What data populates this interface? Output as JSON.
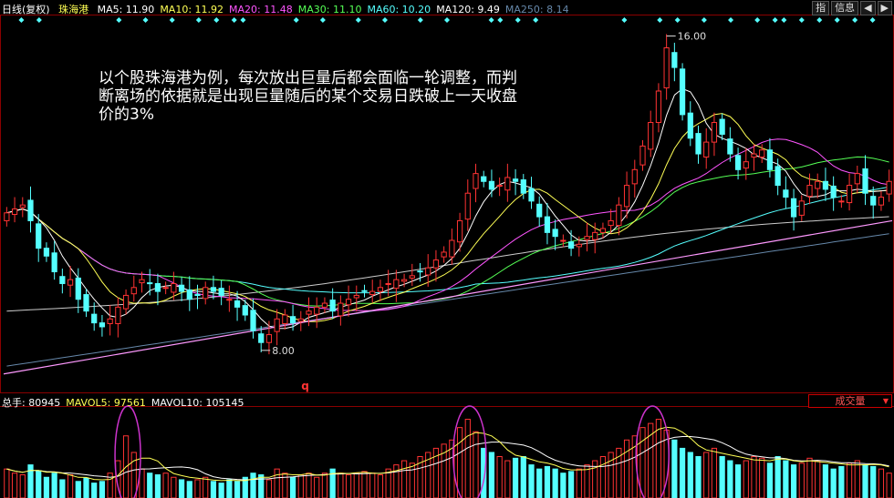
{
  "header": {
    "period": "日线(复权)",
    "stock": "珠海港",
    "ma_items": [
      {
        "text": "MA5: 11.90",
        "color": "#ffffff"
      },
      {
        "text": "MA10: 11.92",
        "color": "#ffff55"
      },
      {
        "text": "MA20: 11.48",
        "color": "#ff55ff"
      },
      {
        "text": "MA30: 11.10",
        "color": "#55ff55"
      },
      {
        "text": "MA60: 10.20",
        "color": "#55ffff"
      },
      {
        "text": "MA120: 9.49",
        "color": "#ffffff"
      },
      {
        "text": "MA250: 8.14",
        "color": "#6688aa"
      }
    ]
  },
  "top_buttons": [
    "指",
    "信息",
    "◀",
    "▶"
  ],
  "annotation": "以个股珠海港为例，每次放出巨量后都会面临一轮调整，而判断离场的依据就是出现巨量随后的某个交易日跌破上一天收盘价的3%",
  "marker_q": "q",
  "volume_header": {
    "items": [
      {
        "text": "总手: 80945",
        "color": "#ffffff"
      },
      {
        "text": "MAVOL5: 97561",
        "color": "#ffff55"
      },
      {
        "text": "MAVOL10: 105145",
        "color": "#ffffff"
      }
    ]
  },
  "volume_selector": "成交量",
  "chart_data": {
    "type": "candlestick",
    "price_range": [
      7.0,
      16.5
    ],
    "high_label": "16.00",
    "low_label": "8.00",
    "high_value": 16.0,
    "low_value": 8.0,
    "closes": [
      11.5,
      11.6,
      11.7,
      11.3,
      10.6,
      10.4,
      10.0,
      9.7,
      9.8,
      9.3,
      9.0,
      8.7,
      8.6,
      8.8,
      9.1,
      9.4,
      9.6,
      9.8,
      9.7,
      9.5,
      9.6,
      9.7,
      9.5,
      9.3,
      9.4,
      9.6,
      9.5,
      9.4,
      9.3,
      9.1,
      8.9,
      8.5,
      8.2,
      8.4,
      8.8,
      8.9,
      8.7,
      8.8,
      9.0,
      9.1,
      9.2,
      9.0,
      9.2,
      9.3,
      9.4,
      9.5,
      9.5,
      9.6,
      9.7,
      9.8,
      9.8,
      9.9,
      10.0,
      10.1,
      10.3,
      10.5,
      10.8,
      11.3,
      12.0,
      12.5,
      12.3,
      12.1,
      12.2,
      12.4,
      12.3,
      12.0,
      11.8,
      11.4,
      11.0,
      10.9,
      10.8,
      10.6,
      10.7,
      10.9,
      11.0,
      11.1,
      11.3,
      11.7,
      12.2,
      12.6,
      13.2,
      13.8,
      14.6,
      15.7,
      15.2,
      14.0,
      13.4,
      13.0,
      13.3,
      13.8,
      13.5,
      13.0,
      12.6,
      12.8,
      13.0,
      13.1,
      12.6,
      12.2,
      11.9,
      11.4,
      11.8,
      12.2,
      12.3,
      12.1,
      11.9,
      11.8,
      12.2,
      12.5,
      12.0,
      11.7,
      11.9,
      12.3
    ],
    "volumes": [
      0.35,
      0.3,
      0.28,
      0.4,
      0.33,
      0.25,
      0.3,
      0.22,
      0.28,
      0.2,
      0.24,
      0.18,
      0.2,
      0.3,
      0.45,
      0.75,
      0.55,
      0.35,
      0.3,
      0.28,
      0.3,
      0.25,
      0.22,
      0.2,
      0.22,
      0.25,
      0.2,
      0.18,
      0.22,
      0.2,
      0.25,
      0.3,
      0.28,
      0.22,
      0.35,
      0.3,
      0.25,
      0.28,
      0.3,
      0.25,
      0.3,
      0.35,
      0.3,
      0.28,
      0.3,
      0.32,
      0.3,
      0.28,
      0.35,
      0.4,
      0.45,
      0.42,
      0.5,
      0.55,
      0.6,
      0.65,
      0.7,
      0.85,
      0.95,
      0.8,
      0.6,
      0.55,
      0.5,
      0.45,
      0.48,
      0.5,
      0.4,
      0.35,
      0.38,
      0.35,
      0.3,
      0.32,
      0.35,
      0.4,
      0.45,
      0.5,
      0.55,
      0.6,
      0.7,
      0.75,
      0.85,
      0.9,
      0.95,
      0.82,
      0.7,
      0.6,
      0.55,
      0.5,
      0.55,
      0.6,
      0.5,
      0.45,
      0.4,
      0.45,
      0.5,
      0.48,
      0.42,
      0.5,
      0.45,
      0.4,
      0.42,
      0.48,
      0.45,
      0.4,
      0.35,
      0.38,
      0.42,
      0.45,
      0.4,
      0.38,
      0.35,
      0.3
    ],
    "colors": {
      "up": "#ff3333",
      "down": "#55ffff",
      "ma5": "#ffffff",
      "ma10": "#ffff55",
      "ma20": "#ff55ff",
      "ma30": "#55ff55",
      "ma60": "#55ffff",
      "ma120": "#ffffff",
      "ma250": "#6688aa",
      "trendline": "#ff99ff",
      "circle": "#cc33cc"
    }
  }
}
